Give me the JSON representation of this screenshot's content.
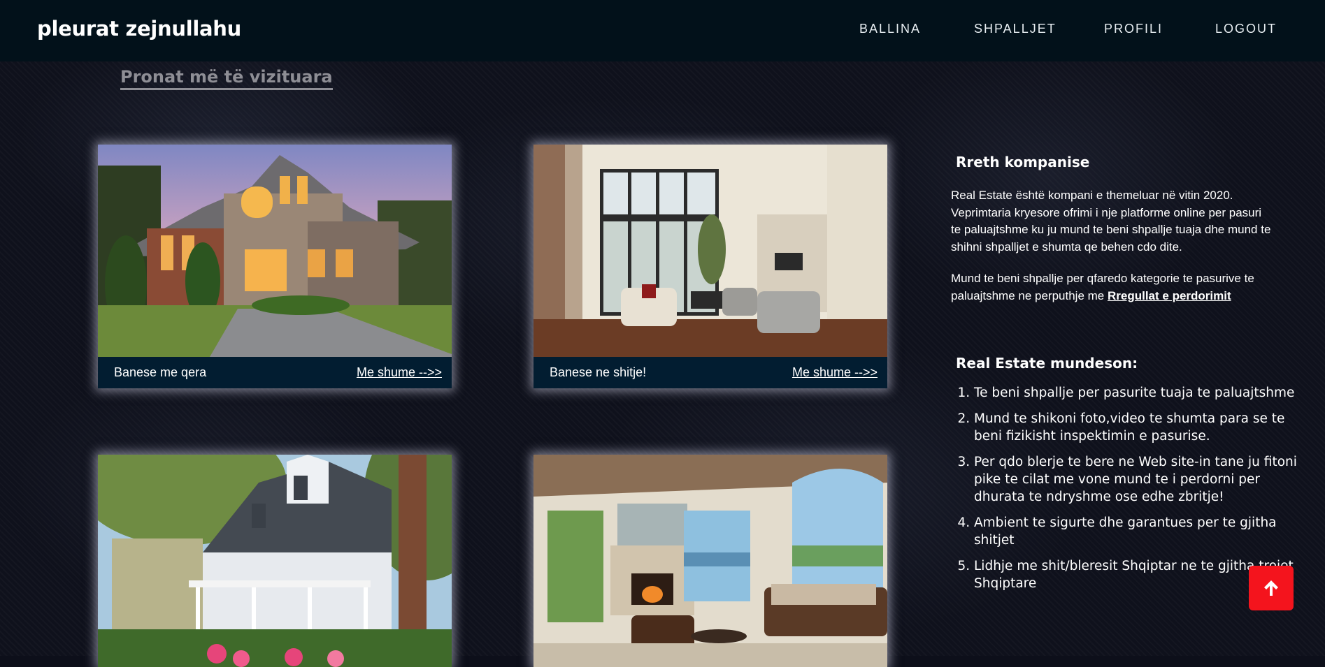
{
  "header": {
    "brand": "pleurat zejnullahu",
    "nav": [
      "BALLINA",
      "SHPALLJET",
      "PROFILI",
      "LOGOUT"
    ]
  },
  "main": {
    "section_title": "Pronat më të vizituara",
    "cards": [
      {
        "label": "Banese me qera",
        "more": "Me shume -->>",
        "image": "brick-house-at-dusk"
      },
      {
        "label": "Banese ne shitje!",
        "more": "Me shume -->>",
        "image": "bright-living-room-interior"
      },
      {
        "label": "",
        "more": "",
        "image": "white-house-with-porch-and-flowers"
      },
      {
        "label": "",
        "more": "",
        "image": "living-room-with-fireplace-and-sea-view"
      }
    ]
  },
  "aside": {
    "about_title": "Rreth kompanise",
    "about_p1": "Real Estate është kompani e themeluar në vitin 2020. Veprimtaria kryesore ofrimi i nje platforme online per pasuri te paluajtshme ku ju mund te beni shpallje tuaja dhe mund te shihni shpalljet e shumta qe behen cdo dite.",
    "about_p2": "Mund te beni shpallje per qfaredo kategorie te pasurive te paluajtshme ne perputhje me",
    "rules_link": "Rregullat e perdorimit",
    "offers_title": "Real Estate mundeson:",
    "offers": [
      "Te beni shpallje per pasurite tuaja te paluajtshme",
      "Mund te shikoni foto,video te shumta para se te beni fizikisht inspektimin e pasurise.",
      "Per qdo blerje te bere ne Web site-in tane ju fitoni pike te cilat me vone mund te i perdorni per dhurata te ndryshme ose edhe zbritje!",
      "Ambient te sigurte dhe garantues per te gjitha shitjet",
      "Lidhje me shit/bleresit Shqiptar ne te gjitha trojet Shqiptare"
    ]
  },
  "scroll_top": {
    "icon": "arrow-up-icon",
    "color": "#f4141d"
  }
}
